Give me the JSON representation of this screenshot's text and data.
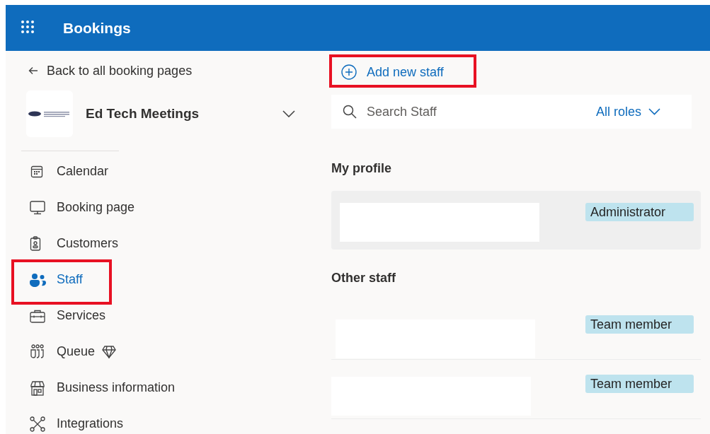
{
  "header": {
    "title": "Bookings"
  },
  "sidebar": {
    "back_link": "Back to all booking pages",
    "business": {
      "name": "Ed Tech Meetings",
      "expanded": false
    },
    "items": [
      {
        "label": "Calendar",
        "selected": false,
        "highlighted": false,
        "premium": false
      },
      {
        "label": "Booking page",
        "selected": false,
        "highlighted": false,
        "premium": false
      },
      {
        "label": "Customers",
        "selected": false,
        "highlighted": false,
        "premium": false
      },
      {
        "label": "Staff",
        "selected": true,
        "highlighted": true,
        "premium": false
      },
      {
        "label": "Services",
        "selected": false,
        "highlighted": false,
        "premium": false
      },
      {
        "label": "Queue",
        "selected": false,
        "highlighted": false,
        "premium": true
      },
      {
        "label": "Business information",
        "selected": false,
        "highlighted": false,
        "premium": false
      },
      {
        "label": "Integrations",
        "selected": false,
        "highlighted": false,
        "premium": false
      }
    ]
  },
  "main": {
    "add_button": {
      "label": "Add new staff",
      "highlighted": true
    },
    "search": {
      "placeholder": "Search Staff"
    },
    "role_filter": "All roles",
    "sections": [
      {
        "title": "My profile",
        "kind": "card",
        "staff": [
          {
            "role": "Administrator"
          }
        ]
      },
      {
        "title": "Other staff",
        "kind": "list",
        "staff": [
          {
            "role": "Team member"
          },
          {
            "role": "Team member"
          }
        ]
      }
    ]
  }
}
